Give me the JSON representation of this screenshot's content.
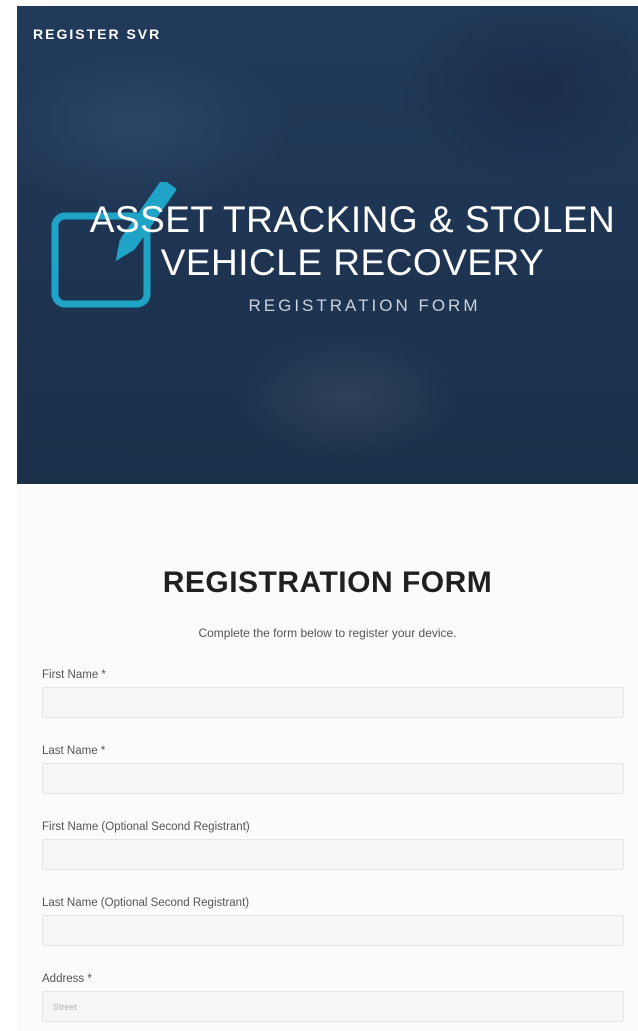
{
  "hero": {
    "brand": "REGISTER SVR",
    "title_line1": "ASSET TRACKING & STOLEN",
    "title_line2": "VEHICLE RECOVERY",
    "subtitle": "REGISTRATION FORM",
    "icon": "checkbox-pencil-icon",
    "accent_color": "#1fa3c7"
  },
  "form": {
    "title": "REGISTRATION FORM",
    "intro": "Complete the form below to register your device.",
    "fields": [
      {
        "label": "First Name *",
        "value": "",
        "placeholder": ""
      },
      {
        "label": "Last Name *",
        "value": "",
        "placeholder": ""
      },
      {
        "label": "First Name (Optional Second Registrant)",
        "value": "",
        "placeholder": ""
      },
      {
        "label": "Last Name (Optional Second Registrant)",
        "value": "",
        "placeholder": ""
      },
      {
        "label": "Address *",
        "value": "",
        "placeholder": "Street"
      }
    ]
  }
}
